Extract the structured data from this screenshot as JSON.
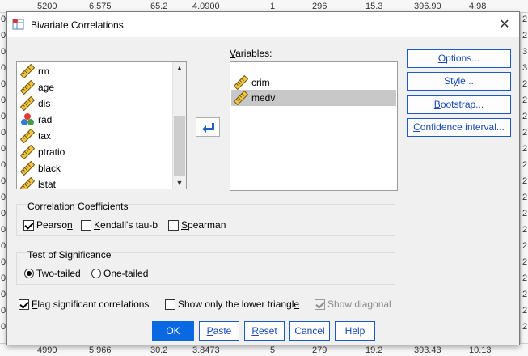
{
  "background": {
    "top_row": [
      "5200",
      "6.575",
      "65.2",
      "4.0900",
      "1",
      "296",
      "15.3",
      "396.90",
      "4.98"
    ],
    "bottom_row": [
      "4990",
      "5.966",
      "30.2",
      "3.8473",
      "5",
      "279",
      "19.2",
      "393.43",
      "10.13"
    ],
    "left_col": [
      "0",
      "0",
      "0",
      "0",
      "0",
      "0",
      "0",
      "0",
      "0",
      "0",
      "0",
      "0",
      "0",
      "0",
      "0",
      "0",
      "0",
      "0",
      "0",
      "0"
    ],
    "right_col": [
      "2",
      "2",
      "3",
      "3",
      "2",
      "2",
      "2",
      "2",
      "2",
      "2",
      "2",
      "2",
      "2",
      "2",
      "2",
      "2",
      "2",
      "2",
      "2",
      "2"
    ]
  },
  "dialog": {
    "title": "Bivariate Correlations",
    "close_glyph": "✕"
  },
  "source_list": {
    "items": [
      {
        "label": "rm",
        "icon": "scale-icon"
      },
      {
        "label": "age",
        "icon": "scale-icon"
      },
      {
        "label": "dis",
        "icon": "scale-icon"
      },
      {
        "label": "rad",
        "icon": "nominal-icon"
      },
      {
        "label": "tax",
        "icon": "scale-icon"
      },
      {
        "label": "ptratio",
        "icon": "scale-icon"
      },
      {
        "label": "black",
        "icon": "scale-icon"
      },
      {
        "label": "lstat",
        "icon": "scale-icon"
      }
    ]
  },
  "variables": {
    "label_mnemonic": "V",
    "label_rest": "ariables:",
    "items": [
      {
        "label": "crim",
        "icon": "scale-icon",
        "selected": false
      },
      {
        "label": "medv",
        "icon": "scale-icon",
        "selected": true
      }
    ]
  },
  "side_buttons": {
    "options": {
      "mnemonic": "O",
      "rest": "ptions..."
    },
    "style": {
      "pre": "St",
      "mnemonic": "y",
      "rest": "le..."
    },
    "bootstrap": {
      "mnemonic": "B",
      "rest": "ootstrap..."
    },
    "confidence": {
      "mnemonic": "C",
      "rest": "onfidence interval..."
    }
  },
  "correlation_coefficients": {
    "title": "Correlation Coefficients",
    "pearson": {
      "pre": "Pearso",
      "mnemonic": "n",
      "rest": "",
      "checked": true
    },
    "kendall": {
      "mnemonic": "K",
      "rest": "endall's tau-b",
      "checked": false
    },
    "spearman": {
      "mnemonic": "S",
      "rest": "pearman",
      "checked": false
    }
  },
  "test_of_significance": {
    "title": "Test of Significance",
    "two_tailed": {
      "mnemonic": "T",
      "rest": "wo-tailed",
      "checked": true
    },
    "one_tailed": {
      "pre": "One-tai",
      "mnemonic": "l",
      "rest": "ed",
      "checked": false
    }
  },
  "options": {
    "flag": {
      "mnemonic": "F",
      "rest": "lag significant correlations",
      "checked": true
    },
    "lower_triangle": {
      "pre": "Show only the lower triangl",
      "mnemonic": "e",
      "rest": "",
      "checked": false
    },
    "show_diagonal": {
      "label": "Show diagonal",
      "checked": true,
      "disabled": true
    }
  },
  "bottom_buttons": {
    "ok": "OK",
    "paste": {
      "mnemonic": "P",
      "rest": "aste"
    },
    "reset": {
      "mnemonic": "R",
      "rest": "eset"
    },
    "cancel": "Cancel",
    "help": "Help"
  },
  "colors": {
    "accent": "#0a68e3",
    "link": "#1a4ab8",
    "dialog_bg": "#f0f0f0",
    "selection": "#c8c8c8"
  }
}
